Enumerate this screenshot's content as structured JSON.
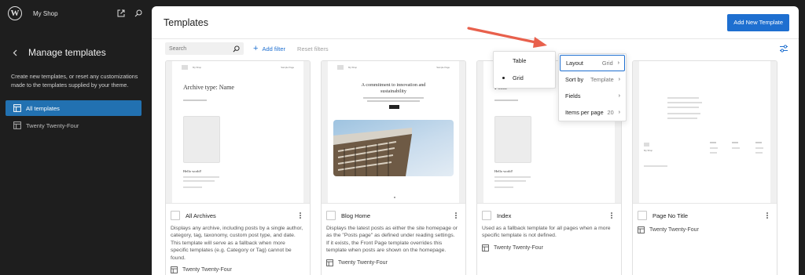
{
  "site": {
    "name": "My Shop"
  },
  "sidebar": {
    "title": "Manage templates",
    "description": "Create new templates, or reset any customizations made to the templates supplied by your theme.",
    "items": [
      {
        "label": "All templates"
      },
      {
        "label": "Twenty Twenty-Four"
      }
    ]
  },
  "main": {
    "title": "Templates",
    "add_new_label": "Add New Template",
    "search_placeholder": "Search",
    "add_filter_label": "Add filter",
    "reset_filters_label": "Reset filters"
  },
  "cards": [
    {
      "name": "All Archives",
      "description": "Displays any archive, including posts by a single author, category, tag, taxonomy, custom post type, and date. This template will serve as a fallback when more specific templates (e.g. Category or Tag) cannot be found.",
      "theme": "Twenty Twenty-Four",
      "preview": {
        "site": "My Shop",
        "nav": "Sample Page",
        "heading": "Archive type: Name",
        "post": "Hello world!"
      }
    },
    {
      "name": "Blog Home",
      "description": "Displays the latest posts as either the site homepage or as the \"Posts page\" as defined under reading settings. If it exists, the Front Page template overrides this template when posts are shown on the homepage.",
      "theme": "Twenty Twenty-Four",
      "preview": {
        "site": "My Shop",
        "nav": "Sample Page",
        "heading": "A commitment to innovation and sustainability"
      }
    },
    {
      "name": "Index",
      "description": "Used as a fallback template for all pages when a more specific template is not defined.",
      "theme": "Twenty Twenty-Four",
      "preview": {
        "site": "My Shop",
        "nav": "Sample Page",
        "heading": "Posts",
        "post": "Hello world!"
      }
    },
    {
      "name": "Page No Title",
      "description": "",
      "theme": "Twenty Twenty-Four",
      "preview": {
        "site": "My Shop"
      }
    }
  ],
  "layout_menu": {
    "options": [
      {
        "label": "Table",
        "selected": false
      },
      {
        "label": "Grid",
        "selected": true
      }
    ]
  },
  "view_menu": {
    "rows": [
      {
        "label": "Layout",
        "value": "Grid"
      },
      {
        "label": "Sort by",
        "value": "Template"
      },
      {
        "label": "Fields",
        "value": ""
      },
      {
        "label": "Items per page",
        "value": "20"
      }
    ]
  },
  "colors": {
    "accent": "#1e6fd0",
    "sidebar_bg": "#1e1e1e",
    "arrow": "#e8604c"
  },
  "icons": [
    "wordpress-logo",
    "external-link-icon",
    "search-icon",
    "chevron-left-icon",
    "layout-icon",
    "plus-icon",
    "sliders-icon",
    "more-vertical-icon",
    "chevron-right-icon"
  ]
}
